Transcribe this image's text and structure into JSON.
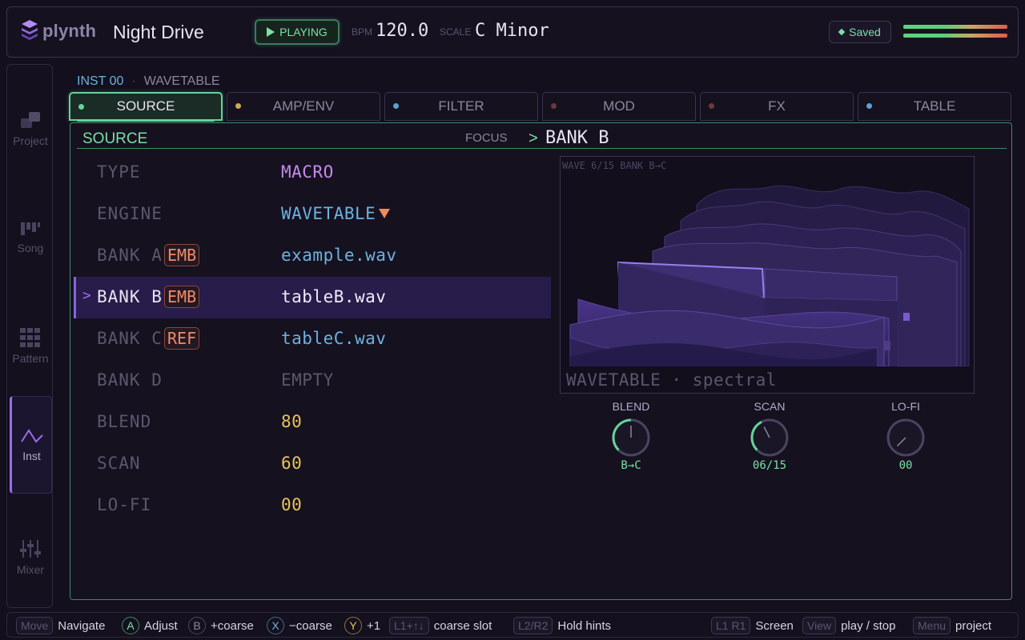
{
  "header": {
    "app_name": "plynth",
    "project_name": "Night Drive",
    "transport_label": "PLAYING",
    "bpm_label": "BPM",
    "bpm_value": "120.0",
    "scale_label": "SCALE",
    "scale_value": "C Minor",
    "saved_label": "Saved"
  },
  "sidebar": {
    "items": [
      {
        "label": "Project",
        "icon": "project-icon",
        "active": false
      },
      {
        "label": "Song",
        "icon": "song-icon",
        "active": false
      },
      {
        "label": "Pattern",
        "icon": "pattern-icon",
        "active": false
      },
      {
        "label": "Inst",
        "icon": "inst-wave-icon",
        "active": true
      },
      {
        "label": "Mixer",
        "icon": "mixer-icon",
        "active": false
      }
    ]
  },
  "breadcrumb": {
    "instrument": "INST 00",
    "separator": "·",
    "engine": "WAVETABLE"
  },
  "tabs": [
    {
      "label": "SOURCE",
      "dot_color": "#64d49a",
      "active": true
    },
    {
      "label": "AMP/ENV",
      "dot_color": "#c9a860",
      "active": false
    },
    {
      "label": "FILTER",
      "dot_color": "#5aa4d0",
      "active": false
    },
    {
      "label": "MOD",
      "dot_color": "#6a3a40",
      "active": false
    },
    {
      "label": "FX",
      "dot_color": "#6a3a40",
      "active": false
    },
    {
      "label": "TABLE",
      "dot_color": "#5aa4d0",
      "active": false
    }
  ],
  "panel": {
    "title": "SOURCE",
    "focus_label": "FOCUS",
    "focus_arrow": ">",
    "focus_value": "BANK B"
  },
  "params": [
    {
      "label": "TYPE",
      "tag": "",
      "value": "MACRO",
      "style": "v-macro"
    },
    {
      "label": "ENGINE",
      "tag": "",
      "value": "WAVETABLE",
      "style": "v-blue"
    },
    {
      "label": "BANK A",
      "tag": "EMB",
      "value": "example.wav",
      "style": "v-blue"
    },
    {
      "label": "BANK B",
      "tag": "EMB",
      "value": "tableB.wav",
      "style": "v-white",
      "selected": true,
      "cursor": ">"
    },
    {
      "label": "BANK C",
      "tag": "REF",
      "value": "tableC.wav",
      "style": "v-blue"
    },
    {
      "label": "BANK D",
      "tag": "",
      "value": "EMPTY",
      "style": "v-gray"
    },
    {
      "label": "BLEND",
      "tag": "",
      "value": "80",
      "style": "v-yellow"
    },
    {
      "label": "SCAN",
      "tag": "",
      "value": "60",
      "style": "v-yellow"
    },
    {
      "label": "LO-FI",
      "tag": "",
      "value": "00",
      "style": "v-yellow"
    }
  ],
  "viz": {
    "header": "WAVE 6/15  BANK B→C",
    "footer": "WAVETABLE · spectral"
  },
  "knobs": [
    {
      "label": "BLEND",
      "value": "B→C",
      "level": 0.5
    },
    {
      "label": "SCAN",
      "value": "06/15",
      "level": 0.4
    },
    {
      "label": "LO-FI",
      "value": "00",
      "level": 0.0
    }
  ],
  "footer": {
    "hints": [
      {
        "key": "Move",
        "key_style": "rect",
        "text": "Navigate"
      },
      {
        "key": "A",
        "key_style": "circ k-a",
        "text": "Adjust"
      },
      {
        "key": "B",
        "key_style": "circ k-b",
        "text": "+coarse"
      },
      {
        "key": "X",
        "key_style": "circ k-x",
        "text": "−coarse"
      },
      {
        "key": "Y",
        "key_style": "circ k-y",
        "text": "+1"
      },
      {
        "key": "L1+↑↓",
        "key_style": "rect",
        "text": "coarse slot"
      },
      {
        "key": "L2/R2",
        "key_style": "rect",
        "text": "Hold hints"
      },
      {
        "key": "L1 R1",
        "key_style": "rect",
        "text": "Screen"
      },
      {
        "key": "View",
        "key_style": "rect",
        "text": "play / stop"
      },
      {
        "key": "Menu",
        "key_style": "rect",
        "text": "project"
      }
    ]
  },
  "colors": {
    "accent_green": "#7ce0a6",
    "accent_purple": "#9a6ee8",
    "accent_blue": "#6cb2e0",
    "accent_yellow": "#e8c45a",
    "tag_orange": "#f08a6a"
  }
}
